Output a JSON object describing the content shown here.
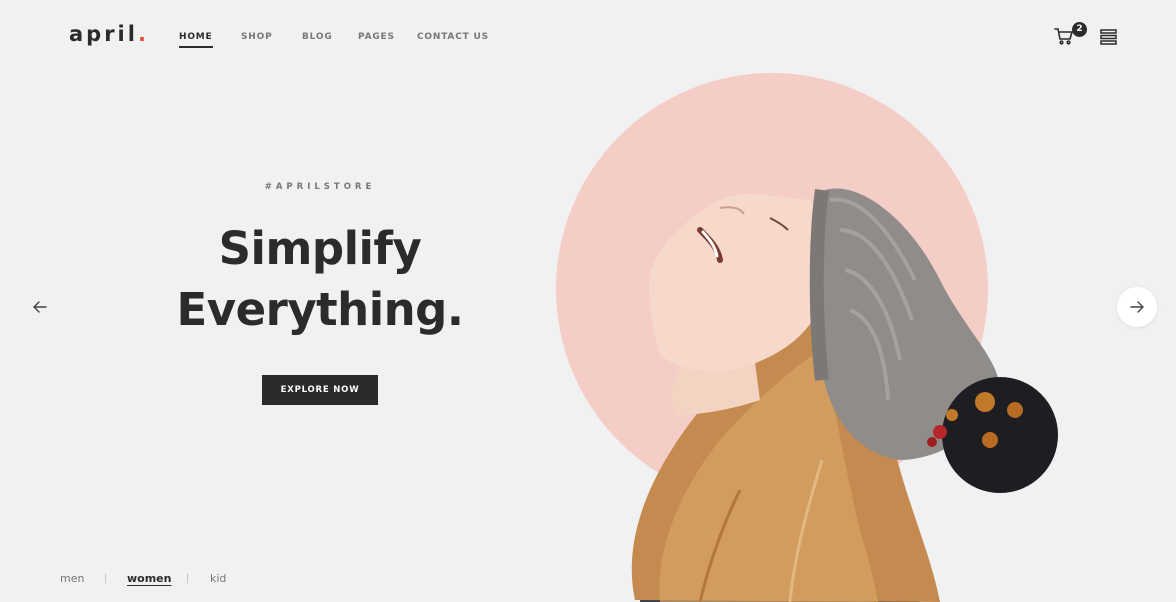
{
  "brand": {
    "name": "april",
    "dot": ".",
    "accent_color": "#e2513e"
  },
  "nav": {
    "items": [
      {
        "label": "HOME",
        "active": true
      },
      {
        "label": "SHOP",
        "active": false
      },
      {
        "label": "BLOG",
        "active": false
      },
      {
        "label": "PAGES",
        "active": false
      },
      {
        "label": "CONTACT US",
        "active": false
      }
    ]
  },
  "header_actions": {
    "cart_icon": "cart-icon",
    "cart_count": "2",
    "menu_icon": "menu-icon"
  },
  "hero": {
    "tagline": "#APRILSTORE",
    "headline_line1": "Simplify",
    "headline_line2": "Everything.",
    "cta_label": "EXPLORE NOW",
    "circle_color": "#f5cdc7",
    "prev_icon": "arrow-left-icon",
    "next_icon": "arrow-right-icon"
  },
  "categories": {
    "items": [
      {
        "label": "men",
        "active": false
      },
      {
        "label": "women",
        "active": true
      },
      {
        "label": "kid",
        "active": false
      }
    ],
    "separator": "|"
  }
}
